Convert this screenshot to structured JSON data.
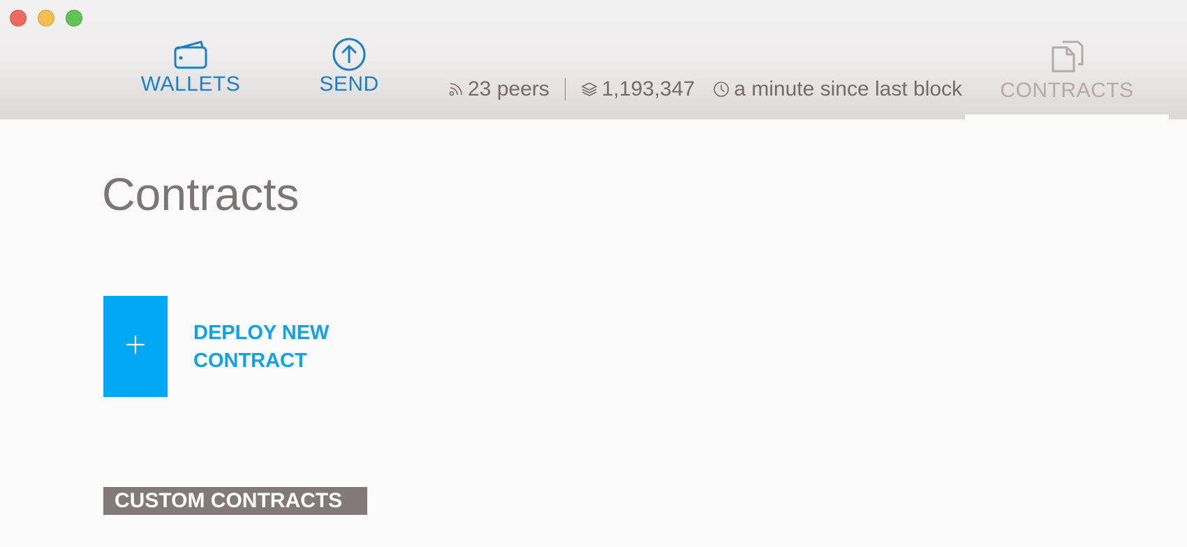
{
  "window": {
    "controls": [
      "close",
      "minimize",
      "maximize"
    ]
  },
  "nav": {
    "wallets": {
      "label": "WALLETS",
      "icon": "wallet-icon",
      "color": "#1b80c5"
    },
    "send": {
      "label": "SEND",
      "icon": "arrow-up-circle-icon",
      "color": "#1b80c5"
    },
    "contracts": {
      "label": "CONTRACTS",
      "icon": "documents-icon",
      "color": "#b6a9a9",
      "active": true
    }
  },
  "status": {
    "peers": "23 peers",
    "block_number": "1,193,347",
    "last_block": "a minute since last block"
  },
  "main": {
    "title": "Contracts",
    "deploy_button": {
      "symbol": "+",
      "label_line1": "DEPLOY NEW",
      "label_line2": "CONTRACT",
      "accent": "#02a8f3"
    },
    "section_label": "CUSTOM CONTRACTS"
  }
}
